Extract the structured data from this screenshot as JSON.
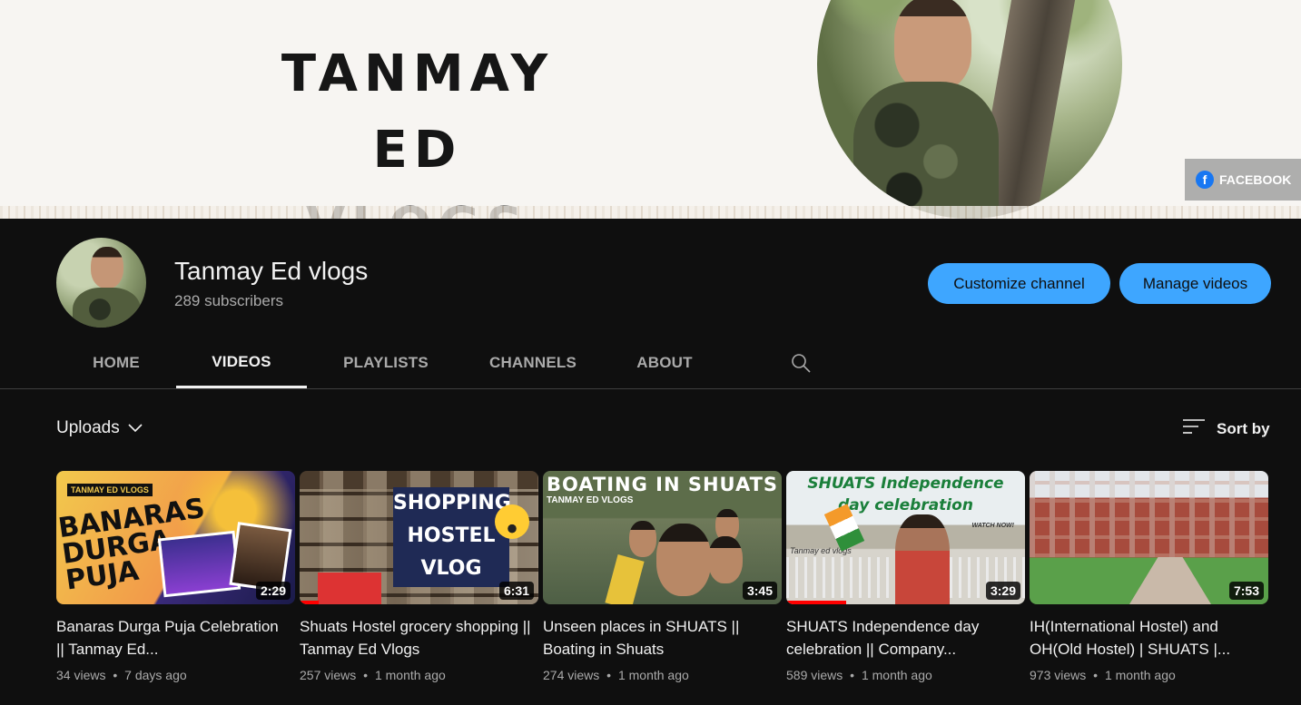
{
  "banner": {
    "title_line1": "TANMAY ED",
    "title_line2": "VLOGS",
    "link_label": "FACEBOOK",
    "link_icon": "facebook-icon"
  },
  "channel": {
    "name": "Tanmay Ed vlogs",
    "subscribers": "289 subscribers",
    "customize_label": "Customize channel",
    "manage_label": "Manage videos"
  },
  "tabs": [
    {
      "label": "HOME",
      "active": false
    },
    {
      "label": "VIDEOS",
      "active": true
    },
    {
      "label": "PLAYLISTS",
      "active": false
    },
    {
      "label": "CHANNELS",
      "active": false
    },
    {
      "label": "ABOUT",
      "active": false
    }
  ],
  "uploads_label": "Uploads",
  "sort_label": "Sort by",
  "colors": {
    "background": "#0f0f0f",
    "accent_button": "#3ea6ff",
    "progress": "#ff0000",
    "secondary_text": "#aaaaaa"
  },
  "videos": [
    {
      "title": "Banaras Durga Puja Celebration || Tanmay Ed...",
      "views": "34 views",
      "age": "7 days ago",
      "duration": "2:29",
      "thumb_text": {
        "tag": "TANMAY ED VLOGS",
        "main": "BANARAS DURGA PUJA"
      },
      "watched_fraction": 0
    },
    {
      "title": "Shuats Hostel grocery shopping || Tanmay Ed Vlogs",
      "views": "257 views",
      "age": "1 month ago",
      "duration": "6:31",
      "thumb_text": {
        "line1": "SHOPPING",
        "line2": "HOSTEL",
        "line3": "VLOG"
      },
      "watched_fraction": 0.08
    },
    {
      "title": "Unseen places in SHUATS || Boating in Shuats",
      "views": "274 views",
      "age": "1 month ago",
      "duration": "3:45",
      "thumb_text": {
        "main": "BOATING IN SHUATS",
        "sub": "TANMAY ED VLOGS"
      },
      "watched_fraction": 0
    },
    {
      "title": "SHUATS Independence day celebration || Company...",
      "views": "589 views",
      "age": "1 month ago",
      "duration": "3:29",
      "thumb_text": {
        "main": "SHUATS Independence day celebration",
        "watch": "WATCH NOW!",
        "tag": "Tanmay ed vlogs"
      },
      "watched_fraction": 0.25
    },
    {
      "title": "IH(International Hostel) and OH(Old Hostel) | SHUATS |...",
      "views": "973 views",
      "age": "1 month ago",
      "duration": "7:53",
      "thumb_text": {},
      "watched_fraction": 0
    }
  ],
  "meta_separator": "•"
}
